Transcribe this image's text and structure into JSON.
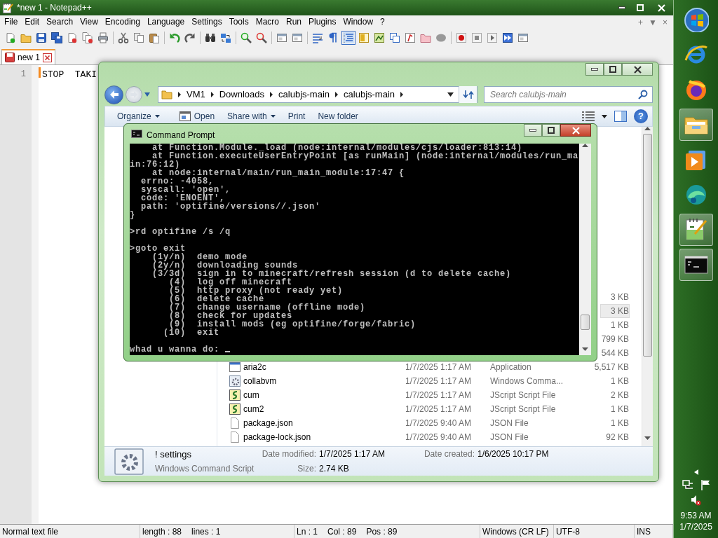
{
  "notepad": {
    "title": "*new 1 - Notepad++",
    "menu": [
      "File",
      "Edit",
      "Search",
      "View",
      "Encoding",
      "Language",
      "Settings",
      "Tools",
      "Macro",
      "Run",
      "Plugins",
      "Window",
      "?"
    ],
    "menu_right": [
      "+",
      "▼",
      "×"
    ],
    "tabs": [
      {
        "label": "new 1",
        "selected": true
      }
    ],
    "editor": {
      "line_numbers": [
        "1"
      ],
      "lines": [
        "STOP  TAKI"
      ]
    },
    "status_bar": {
      "file_type": "Normal text file",
      "length": "length : 88",
      "lines": "lines : 1",
      "ln": "Ln : 1",
      "col": "Col : 89",
      "pos": "Pos : 89",
      "eol": "Windows (CR LF)",
      "encoding": "UTF-8",
      "mode": "INS"
    }
  },
  "explorer": {
    "breadcrumb": [
      "VM1",
      "Downloads",
      "calubjs-main",
      "calubjs-main"
    ],
    "search": {
      "placeholder": "Search calubjs-main"
    },
    "toolbar": [
      {
        "label": "Organize",
        "kind": "menu"
      },
      {
        "label": "Open",
        "kind": "open"
      },
      {
        "label": "Share with",
        "kind": "menu"
      },
      {
        "label": "Print",
        "kind": "plain"
      },
      {
        "label": "New folder",
        "kind": "plain"
      }
    ],
    "help": "?",
    "files": [
      {
        "size": "3 KB",
        "selected": false
      },
      {
        "size": "3 KB",
        "selected": true
      },
      {
        "size": "1 KB",
        "selected": false
      },
      {
        "size": "799 KB",
        "selected": false
      },
      {
        "size": "544 KB",
        "selected": false
      },
      {
        "name": "aria2c",
        "kind": "app",
        "date": "1/7/2025 1:17 AM",
        "type": "Application",
        "size": "5,517 KB",
        "selected": false
      },
      {
        "name": "collabvm",
        "kind": "cmd-script",
        "date": "1/7/2025 1:17 AM",
        "type": "Windows Comma...",
        "size": "1 KB",
        "selected": false
      },
      {
        "name": "cum",
        "kind": "jscript",
        "date": "1/7/2025 1:17 AM",
        "type": "JScript Script File",
        "size": "2 KB",
        "selected": false
      },
      {
        "name": "cum2",
        "kind": "jscript",
        "date": "1/7/2025 1:17 AM",
        "type": "JScript Script File",
        "size": "1 KB",
        "selected": false
      },
      {
        "name": "package.json",
        "kind": "json",
        "date": "1/7/2025 9:40 AM",
        "type": "JSON File",
        "size": "1 KB",
        "selected": false
      },
      {
        "name": "package-lock.json",
        "kind": "json",
        "date": "1/7/2025 9:40 AM",
        "type": "JSON File",
        "size": "92 KB",
        "selected": false
      }
    ],
    "details": {
      "name": "! settings",
      "type": "Windows Command Script",
      "fields": [
        {
          "label": "Date modified:",
          "value": "1/7/2025 1:17 AM"
        },
        {
          "label": "Date created:",
          "value": "1/6/2025 10:17 PM"
        },
        {
          "label": "Size:",
          "value": "2.74 KB"
        }
      ]
    }
  },
  "cmd": {
    "title": "Command Prompt",
    "blocks": [
      [
        "    at Function.Module._load (node:internal/modules/cjs/loader:813:14)",
        "    at Function.executeUserEntryPoint [as runMain] (node:internal/modules/run_ma",
        "in:76:12)",
        "    at node:internal/main/run_main_module:17:47 {",
        "  errno: -4058,",
        "  syscall: 'open',",
        "  code: 'ENOENT',",
        "  path: 'optifine/versions//.json'",
        "}"
      ],
      [
        ">rd optifine /s /q"
      ],
      [
        ">goto exit",
        "    (1y/n)  demo mode",
        "    (2y/n)  downloading sounds",
        "    (3/3d)  sign in to minecraft/refresh session (d to delete cache)",
        "       (4)  log off minecraft",
        "       (5)  http proxy (not ready yet)",
        "       (6)  delete cache",
        "       (7)  change username (offline mode)",
        "       (8)  check for updates",
        "       (9)  install mods (eg optifine/forge/fabric)",
        "      (10)  exit"
      ]
    ],
    "prompt": "whad u wanna do:"
  },
  "taskbar": {
    "items": [
      {
        "kind": "start",
        "active": false
      },
      {
        "kind": "ie",
        "active": false
      },
      {
        "kind": "firefox",
        "active": false
      },
      {
        "kind": "explorer",
        "active": true
      },
      {
        "kind": "media",
        "active": false
      },
      {
        "kind": "edge",
        "active": false
      },
      {
        "kind": "notepadpp",
        "active": true
      },
      {
        "kind": "cmd",
        "active": true
      }
    ],
    "volume_muted": true,
    "time": "9:53 AM",
    "date": "1/7/2025"
  }
}
